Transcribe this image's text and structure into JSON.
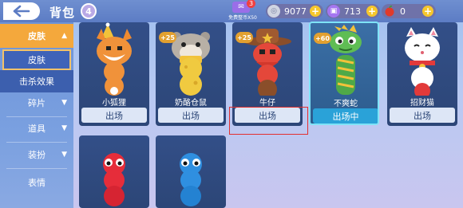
{
  "header": {
    "title": "背包",
    "level": "4"
  },
  "coupon": {
    "badge": "3",
    "label": "免费整币X50"
  },
  "resources": [
    {
      "name": "silver-coin",
      "value": "9077"
    },
    {
      "name": "gift-ticket",
      "value": "713"
    },
    {
      "name": "apple",
      "value": "0"
    }
  ],
  "sidebar": {
    "items": [
      {
        "label": "皮肤",
        "arrow": "▲"
      },
      {
        "label": "皮肤"
      },
      {
        "label": "击杀效果"
      },
      {
        "label": "碎片",
        "arrow": "▼"
      },
      {
        "label": "道具",
        "arrow": "▼"
      },
      {
        "label": "装扮",
        "arrow": "▼"
      },
      {
        "label": "表情"
      }
    ]
  },
  "cards": [
    {
      "name": "小狐狸",
      "button": "出场"
    },
    {
      "name": "奶酪仓鼠",
      "button": "出场",
      "badge": "+25"
    },
    {
      "name": "牛仔",
      "button": "出场",
      "badge": "+25"
    },
    {
      "name": "不爽蛇",
      "button": "出场中",
      "badge": "+60"
    },
    {
      "name": "招财猫",
      "button": "出场"
    }
  ],
  "colors": {
    "accent": "#f4a83c",
    "card_bg": "#334f88",
    "selected_border": "#7fe3f7"
  }
}
